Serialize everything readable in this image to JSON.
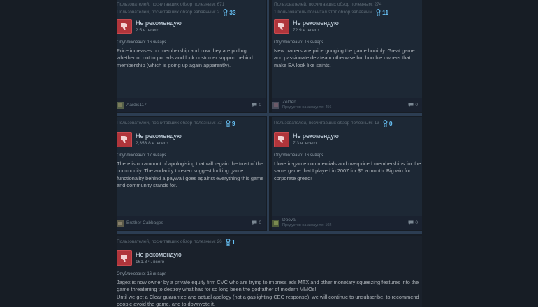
{
  "reviews": [
    {
      "helpful": "Пользователей, посчитавших обзор полезным: 671",
      "funny": "Пользователей, посчитавших обзор забавным: 2",
      "awards": "33",
      "verdict": "Не рекомендую",
      "hours": "2.5 ч. всего",
      "posted": "Опубликовано: 16 января",
      "text": "Price increases on membership and now they are polling whether or not to put ads and lock customer support behind membership (which is going up again apparently).",
      "author": "Aardis117",
      "author_sub": "",
      "comments": "0"
    },
    {
      "helpful": "Пользователей, посчитавших обзор полезным: 274",
      "funny": "1 пользователь посчитал этот обзор забавным",
      "awards": "11",
      "verdict": "Не рекомендую",
      "hours": "72.9 ч. всего",
      "posted": "Опубликовано: 16 января",
      "text": "New owners are price gouging the game horribly. Great game and passionate dev team otherwise but horrible owners that make EA look like saints.",
      "author": "Zelden",
      "author_sub": "Продуктов на аккаунте: 456",
      "comments": "0"
    },
    {
      "helpful": "Пользователей, посчитавших обзор полезным: 72",
      "awards": "9",
      "verdict": "Не рекомендую",
      "hours": "2,353.8 ч. всего",
      "posted": "Опубликовано: 17 января",
      "text": "There is no amount of apologising that will regain the trust of the community. The audacity to even suggest locking game functionality behind a paywall goes against everything this game and community stands for.",
      "author": "Brother Cabbages",
      "author_sub": "",
      "comments": "0"
    },
    {
      "helpful": "Пользователей, посчитавших обзор полезным: 13",
      "awards": "0",
      "verdict": "Не рекомендую",
      "hours": "7.3 ч. всего",
      "posted": "Опубликовано: 16 января",
      "text": "I love in-game commercials and overpriced memberships for the same game that I played in 2007 for $5 a month. Big win for corporate greed!",
      "author": "Doova",
      "author_sub": "Продуктов на аккаунте: 102",
      "comments": "0"
    },
    {
      "helpful": "Пользователей, посчитавших обзор полезным: 26",
      "awards": "1",
      "verdict": "Не рекомендую",
      "hours": "161.8 ч. всего",
      "posted": "Опубликовано: 16 января",
      "text": "Jagex is now owner by a private equity firm CVC who are trying to impress ads MTX and other monetary squeezing features into the game threatening to destroy what has for so long been the godfather of modern MMOs!",
      "text2": "Until we get a Clear guarantee and actual apology (not a gaslighting CEO response), we will continue to unsubscribe, to recommend people avoid the game, and to downvote it."
    }
  ],
  "colors": {
    "accent": "#66c0f4",
    "thumb_down": "#b0353b",
    "background": "#171d25"
  },
  "icons": {
    "award": "award-ribbon-icon",
    "verdict": "thumbs-down-icon",
    "comments": "comment-bubble-icon"
  }
}
